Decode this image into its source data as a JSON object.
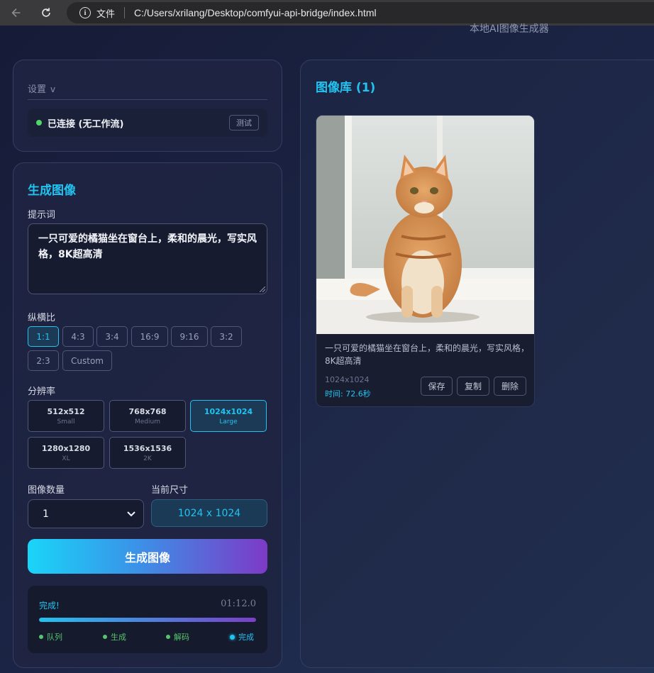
{
  "browser": {
    "address_label": "文件",
    "url": "C:/Users/xrilang/Desktop/comfyui-api-bridge/index.html"
  },
  "header": {
    "subtitle": "本地AI图像生成器"
  },
  "settings": {
    "title": "设置",
    "chevron": "v",
    "status_text": "已连接 (无工作流)",
    "test_label": "测试"
  },
  "generate": {
    "title": "生成图像",
    "prompt_label": "提示词",
    "prompt_value": "一只可爱的橘猫坐在窗台上，柔和的晨光，写实风格，8K超高清",
    "ratio_label": "纵横比",
    "ratios": [
      "1:1",
      "4:3",
      "3:4",
      "16:9",
      "9:16",
      "3:2",
      "2:3",
      "Custom"
    ],
    "selected_ratio": "1:1",
    "resolution_label": "分辨率",
    "resolutions": [
      {
        "size": "512x512",
        "name": "Small"
      },
      {
        "size": "768x768",
        "name": "Medium"
      },
      {
        "size": "1024x1024",
        "name": "Large"
      },
      {
        "size": "1280x1280",
        "name": "XL"
      },
      {
        "size": "1536x1536",
        "name": "2K"
      }
    ],
    "selected_resolution": "1024x1024",
    "count_label": "图像数量",
    "count_value": "1",
    "current_size_label": "当前尺寸",
    "current_size_value": "1024 x 1024",
    "generate_button": "生成图像"
  },
  "progress": {
    "status": "完成!",
    "elapsed": "01:12.0",
    "percent": 100,
    "steps": [
      "队列",
      "生成",
      "解码",
      "完成"
    ],
    "current_step": "完成"
  },
  "gallery": {
    "title": "图像库 (1)",
    "items": [
      {
        "image": "orange-tabby-cat-on-windowsill",
        "description": "一只可爱的橘猫坐在窗台上，柔和的晨光，写实风格，8K超高清",
        "dimensions": "1024x1024",
        "time": "时间: 72.6秒",
        "save_label": "保存",
        "copy_label": "复制",
        "delete_label": "删除"
      }
    ]
  },
  "colors": {
    "accent": "#22c3f0",
    "success": "#4cd964",
    "button_gradient_start": "#1ad5f8",
    "button_gradient_end": "#7d3ac6"
  }
}
